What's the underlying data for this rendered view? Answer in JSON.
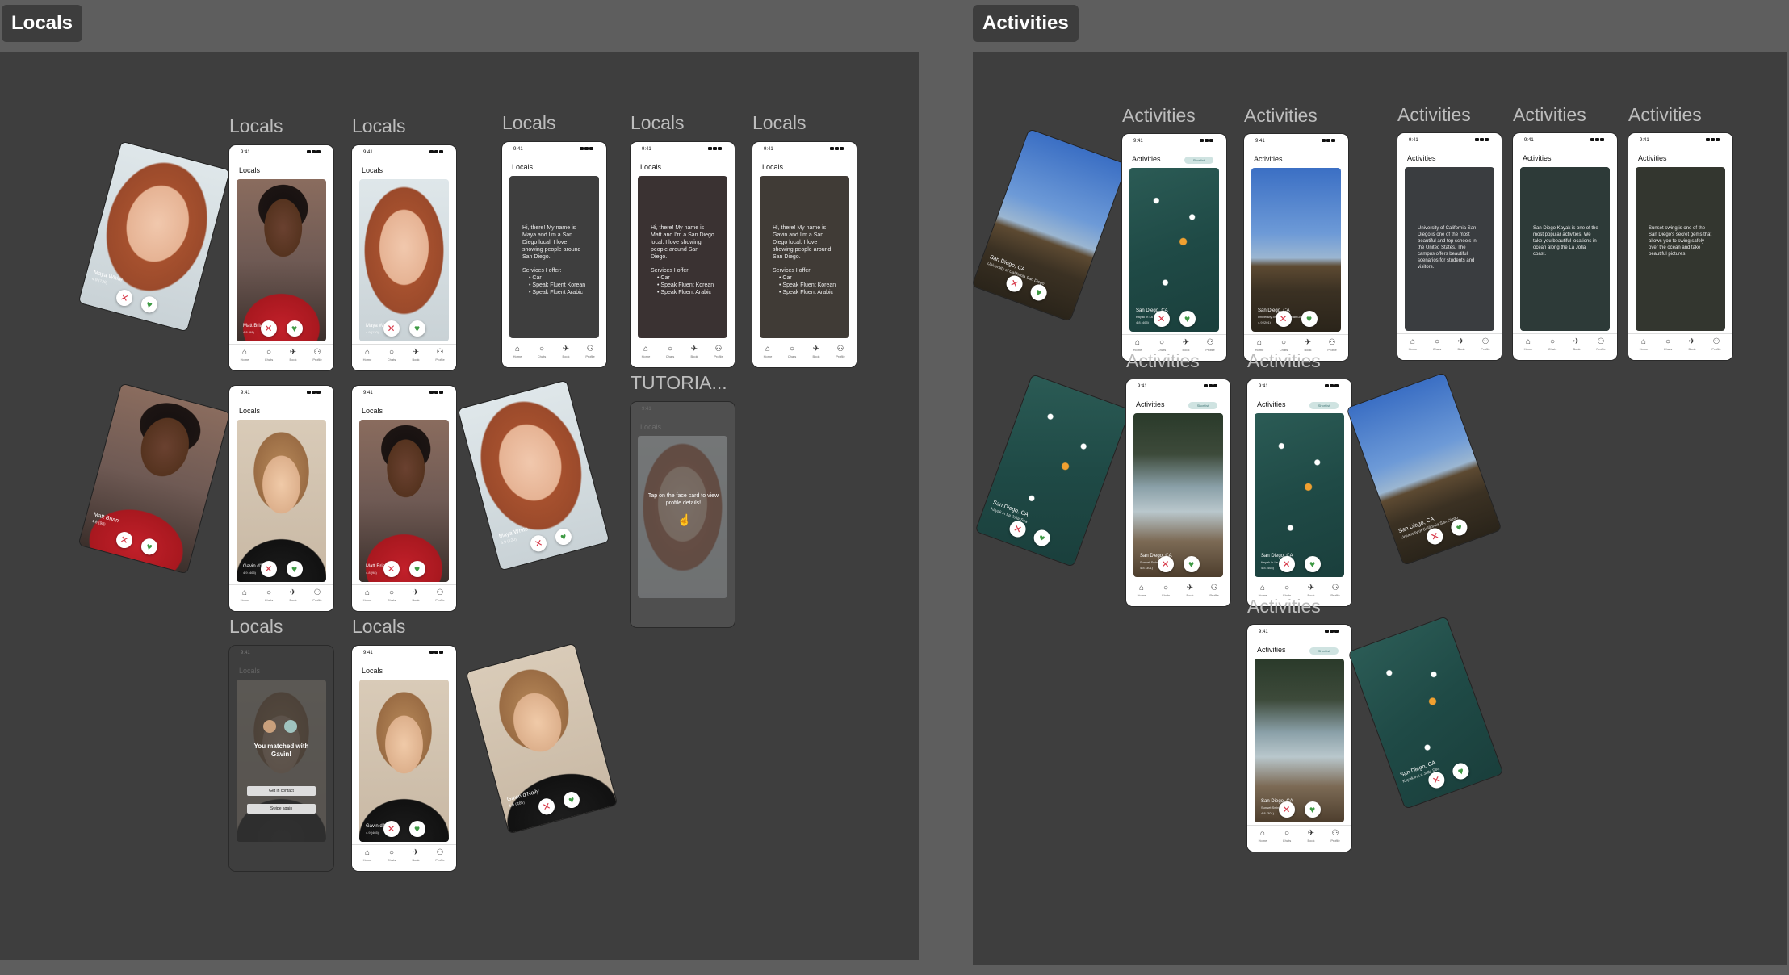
{
  "sections": {
    "left": {
      "tab": "Locals"
    },
    "right": {
      "tab": "Activities"
    }
  },
  "frame_labels": {
    "locals": "Locals",
    "tutorial": "TUTORIA...",
    "activities": "Activities"
  },
  "phone": {
    "time": "9:41",
    "locals_title": "Locals",
    "activities_title": "Activities",
    "chip": "Shortlist",
    "nav": [
      "Home",
      "Chats",
      "Book",
      "Profile"
    ]
  },
  "profiles": {
    "maya": {
      "name": "Maya White",
      "sub": "4.9 (120)"
    },
    "matt": {
      "name": "Matt Brian",
      "sub": "4.8 (98)"
    },
    "gavin": {
      "name": "Gavin d'Nelly",
      "sub": "4.9 (465)"
    }
  },
  "bios": {
    "maya": "Hi, there! My name is Maya and I'm a San Diego local. I love showing people around San Diego.",
    "matt": "Hi, there! My name is Matt and I'm a San Diego local. I love showing people around San Diego.",
    "gavin": "Hi, there! My name is Gavin and I'm a San Diego local. I love showing people around San Diego.",
    "services_heading": "Services I offer:",
    "services": [
      "Car",
      "Speak Fluent Korean",
      "Speak Fluent Arabic"
    ]
  },
  "match": {
    "title": "You matched with Gavin!",
    "btn1": "Get in contact",
    "btn2": "Swipe again"
  },
  "tutorial": {
    "text": "Tap on the face card to view profile details!"
  },
  "activities": {
    "kayak": {
      "place": "San Diego, CA",
      "name": "Kayak in La Jolla Sea",
      "sub": "4.8 (465)"
    },
    "geisel": {
      "place": "San Diego, CA",
      "name": "University of California San Diego",
      "sub": "4.9 (201)"
    },
    "swing": {
      "place": "San Diego, CA",
      "name": "Sunset Swing",
      "sub": "4.8 (301)"
    },
    "desc_ucsd": "University of California San Diego is one of the most beautiful and top schools in the United States. The campus offers beautiful scenarios for students and visitors.",
    "desc_kayak": "San Diego Kayak is one of the most popular activities. We take you beautiful locations in ocean along the La Jolla coast.",
    "desc_swing": "Sunset swing is one of the San Diego's secret gems that allows you to swing safely over the ocean and take beautiful pictures."
  },
  "colors": {
    "canvas": "#5e5e5e",
    "section": "#3e3e3e",
    "reject": "#d83a4a",
    "like": "#3e9a44"
  }
}
